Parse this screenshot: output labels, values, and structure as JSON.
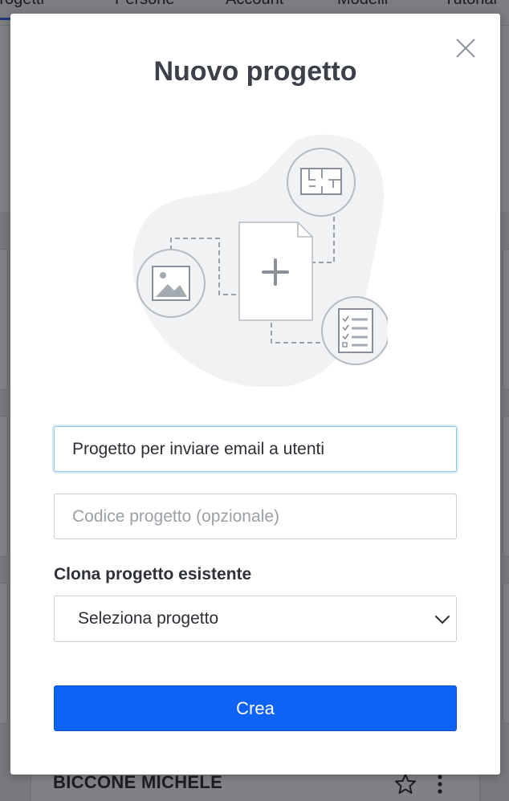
{
  "background": {
    "nav_tabs": [
      "Progetti",
      "Persone",
      "Account",
      "Modelli",
      "Tutorial"
    ],
    "person_name": "BICCONE MICHELE",
    "star_icon": "star-outline-icon",
    "more_icon": "kebab-menu-icon"
  },
  "modal": {
    "title": "Nuovo progetto",
    "close_icon": "close-icon",
    "illustration_icons": [
      "floorplan-icon",
      "image-icon",
      "document-plus-icon",
      "checklist-icon"
    ],
    "project_name": {
      "value": "Progetto per inviare email a utenti",
      "placeholder": ""
    },
    "project_code": {
      "value": "",
      "placeholder": "Codice progetto (opzionale)"
    },
    "clone_label": "Clona progetto esistente",
    "clone_select": {
      "selected": "Seleziona progetto",
      "icon": "chevron-down-icon"
    },
    "submit_label": "Crea"
  },
  "colors": {
    "primary": "#0e63f6",
    "focus_border": "#8fc6e6",
    "title": "#3b4049",
    "overlay": "#7b7d80"
  }
}
